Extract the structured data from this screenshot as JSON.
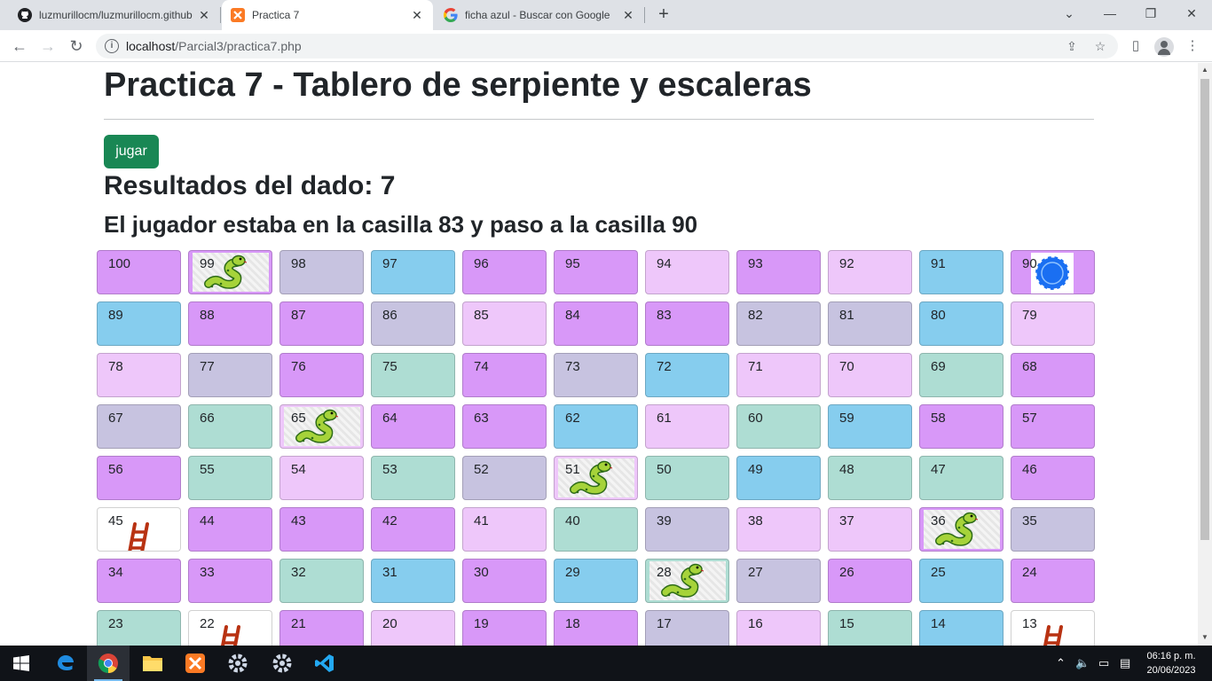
{
  "browser": {
    "tabs": [
      {
        "title": "luzmurillocm/luzmurillocm.github",
        "icon": "github-icon",
        "active": false
      },
      {
        "title": "Practica 7",
        "icon": "xampp-icon",
        "active": true
      },
      {
        "title": "ficha azul - Buscar con Google",
        "icon": "google-icon",
        "active": false
      }
    ],
    "url_host": "localhost",
    "url_path": "/Parcial3/practica7.php"
  },
  "page": {
    "title": "Practica 7 - Tablero de serpiente y escaleras",
    "play_button": "jugar",
    "dice_result": "Resultados del dado: 7",
    "move_text": "El jugador estaba en la casilla 83 y paso a la casilla 90"
  },
  "board": {
    "rows": [
      [
        {
          "n": "100",
          "c": "purple"
        },
        {
          "n": "99",
          "c": "purple",
          "snake": true
        },
        {
          "n": "98",
          "c": "gray"
        },
        {
          "n": "97",
          "c": "blue"
        },
        {
          "n": "96",
          "c": "purple"
        },
        {
          "n": "95",
          "c": "purple"
        },
        {
          "n": "94",
          "c": "lilac"
        },
        {
          "n": "93",
          "c": "purple"
        },
        {
          "n": "92",
          "c": "lilac"
        },
        {
          "n": "91",
          "c": "blue"
        },
        {
          "n": "90",
          "c": "purple",
          "token": true
        }
      ],
      [
        {
          "n": "89",
          "c": "blue"
        },
        {
          "n": "88",
          "c": "purple"
        },
        {
          "n": "87",
          "c": "purple"
        },
        {
          "n": "86",
          "c": "gray"
        },
        {
          "n": "85",
          "c": "lilac"
        },
        {
          "n": "84",
          "c": "purple"
        },
        {
          "n": "83",
          "c": "purple"
        },
        {
          "n": "82",
          "c": "gray"
        },
        {
          "n": "81",
          "c": "gray"
        },
        {
          "n": "80",
          "c": "blue"
        },
        {
          "n": "79",
          "c": "lilac"
        }
      ],
      [
        {
          "n": "78",
          "c": "lilac"
        },
        {
          "n": "77",
          "c": "gray"
        },
        {
          "n": "76",
          "c": "purple"
        },
        {
          "n": "75",
          "c": "green"
        },
        {
          "n": "74",
          "c": "purple"
        },
        {
          "n": "73",
          "c": "gray"
        },
        {
          "n": "72",
          "c": "blue"
        },
        {
          "n": "71",
          "c": "lilac"
        },
        {
          "n": "70",
          "c": "lilac"
        },
        {
          "n": "69",
          "c": "green"
        },
        {
          "n": "68",
          "c": "purple"
        }
      ],
      [
        {
          "n": "67",
          "c": "gray"
        },
        {
          "n": "66",
          "c": "green"
        },
        {
          "n": "65",
          "c": "lilac",
          "snake": true
        },
        {
          "n": "64",
          "c": "purple"
        },
        {
          "n": "63",
          "c": "purple"
        },
        {
          "n": "62",
          "c": "blue"
        },
        {
          "n": "61",
          "c": "lilac"
        },
        {
          "n": "60",
          "c": "green"
        },
        {
          "n": "59",
          "c": "blue"
        },
        {
          "n": "58",
          "c": "purple"
        },
        {
          "n": "57",
          "c": "purple"
        }
      ],
      [
        {
          "n": "56",
          "c": "purple"
        },
        {
          "n": "55",
          "c": "green"
        },
        {
          "n": "54",
          "c": "lilac"
        },
        {
          "n": "53",
          "c": "green"
        },
        {
          "n": "52",
          "c": "gray"
        },
        {
          "n": "51",
          "c": "lilac",
          "snake": true
        },
        {
          "n": "50",
          "c": "green"
        },
        {
          "n": "49",
          "c": "blue"
        },
        {
          "n": "48",
          "c": "green"
        },
        {
          "n": "47",
          "c": "green"
        },
        {
          "n": "46",
          "c": "purple"
        }
      ],
      [
        {
          "n": "45",
          "c": "white",
          "ladder": true
        },
        {
          "n": "44",
          "c": "purple"
        },
        {
          "n": "43",
          "c": "purple"
        },
        {
          "n": "42",
          "c": "purple"
        },
        {
          "n": "41",
          "c": "lilac"
        },
        {
          "n": "40",
          "c": "green"
        },
        {
          "n": "39",
          "c": "gray"
        },
        {
          "n": "38",
          "c": "lilac"
        },
        {
          "n": "37",
          "c": "lilac"
        },
        {
          "n": "36",
          "c": "purple",
          "snake": true
        },
        {
          "n": "35",
          "c": "gray"
        }
      ],
      [
        {
          "n": "34",
          "c": "purple"
        },
        {
          "n": "33",
          "c": "purple"
        },
        {
          "n": "32",
          "c": "green"
        },
        {
          "n": "31",
          "c": "blue"
        },
        {
          "n": "30",
          "c": "purple"
        },
        {
          "n": "29",
          "c": "blue"
        },
        {
          "n": "28",
          "c": "green",
          "snake": true
        },
        {
          "n": "27",
          "c": "gray"
        },
        {
          "n": "26",
          "c": "purple"
        },
        {
          "n": "25",
          "c": "blue"
        },
        {
          "n": "24",
          "c": "purple"
        }
      ],
      [
        {
          "n": "23",
          "c": "green"
        },
        {
          "n": "22",
          "c": "white",
          "ladder": true
        },
        {
          "n": "21",
          "c": "purple"
        },
        {
          "n": "20",
          "c": "lilac"
        },
        {
          "n": "19",
          "c": "purple"
        },
        {
          "n": "18",
          "c": "purple"
        },
        {
          "n": "17",
          "c": "gray"
        },
        {
          "n": "16",
          "c": "lilac"
        },
        {
          "n": "15",
          "c": "green"
        },
        {
          "n": "14",
          "c": "blue"
        },
        {
          "n": "13",
          "c": "white",
          "ladder": true
        }
      ]
    ]
  },
  "colors": {
    "purple": "#d898f8",
    "lilac": "#eec7fa",
    "gray": "#c7c3e0",
    "blue": "#86cdee",
    "green": "#aeddd3",
    "button": "#198754"
  },
  "taskbar": {
    "time": "06:16 p. m.",
    "date": "20/06/2023",
    "apps": [
      "start-icon",
      "edge-icon",
      "chrome-icon",
      "file-explorer-icon",
      "xampp-icon",
      "settings-icon",
      "settings-icon",
      "vscode-icon"
    ]
  }
}
